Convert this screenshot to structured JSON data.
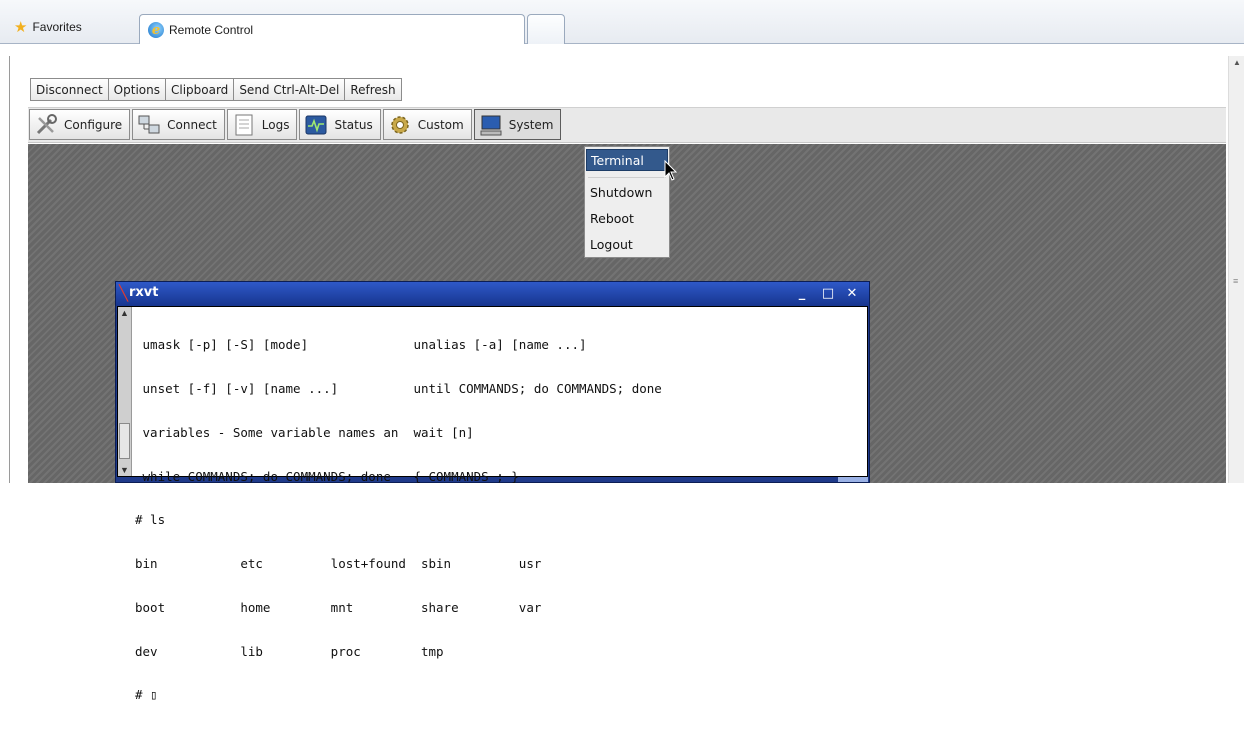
{
  "browser": {
    "favorites_label": "Favorites",
    "active_tab_label": "Remote Control",
    "icons": [
      "star-icon",
      "ie-icon"
    ]
  },
  "toolbar1": {
    "buttons": [
      "Disconnect",
      "Options",
      "Clipboard",
      "Send Ctrl-Alt-Del",
      "Refresh"
    ]
  },
  "toolbar2": {
    "buttons": [
      {
        "label": "Configure",
        "icon": "tools-icon"
      },
      {
        "label": "Connect",
        "icon": "network-icon"
      },
      {
        "label": "Logs",
        "icon": "document-icon"
      },
      {
        "label": "Status",
        "icon": "monitor-pulse-icon"
      },
      {
        "label": "Custom",
        "icon": "gear-icon"
      },
      {
        "label": "System",
        "icon": "computer-icon"
      }
    ]
  },
  "system_menu": {
    "items": [
      "Terminal",
      "Shutdown",
      "Reboot",
      "Logout"
    ],
    "selected": "Terminal"
  },
  "terminal_window": {
    "title": "rxvt",
    "controls": [
      "_",
      "□",
      "✕"
    ],
    "lines": [
      " umask [-p] [-S] [mode]              unalias [-a] [name ...]",
      " unset [-f] [-v] [name ...]          until COMMANDS; do COMMANDS; done",
      " variables - Some variable names an  wait [n]",
      " while COMMANDS; do COMMANDS; done   { COMMANDS ; }",
      "# ls",
      "bin           etc         lost+found  sbin         usr",
      "boot          home        mnt         share        var",
      "dev           lib         proc        tmp",
      "# ▯"
    ]
  },
  "colors": {
    "menu_selected": "#33598c",
    "window_titlebar": "#2348b0",
    "desktop": "#6b6b6b"
  }
}
